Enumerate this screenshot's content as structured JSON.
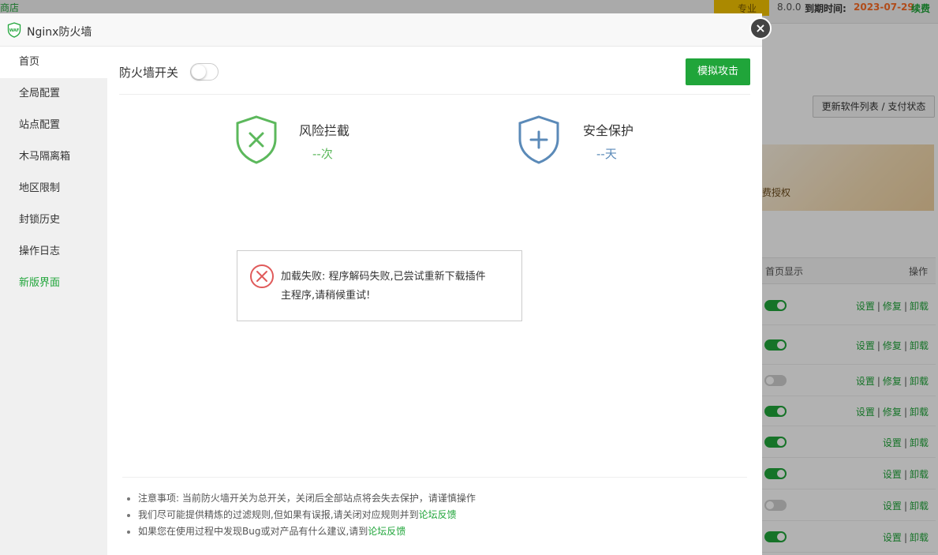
{
  "background": {
    "store_label": "商店",
    "pro_label": "专业",
    "version": "8.0.0",
    "expire_label": "到期时间:",
    "expire_date": "2023-07-29",
    "renew_label": "续费",
    "update_button": "更新软件列表 / 支付状态",
    "banner_text": "费授权",
    "table_headers": {
      "home_display": "首页显示",
      "operations": "操作"
    },
    "rows": [
      {
        "toggle_on": true,
        "ops": [
          "设置",
          "修复",
          "卸载"
        ]
      },
      {
        "toggle_on": true,
        "ops": [
          "设置",
          "修复",
          "卸载"
        ]
      },
      {
        "toggle_on": false,
        "ops": [
          "设置",
          "修复",
          "卸载"
        ]
      },
      {
        "toggle_on": true,
        "ops": [
          "设置",
          "修复",
          "卸载"
        ]
      },
      {
        "toggle_on": true,
        "ops": [
          "设置",
          "卸载"
        ]
      },
      {
        "toggle_on": true,
        "ops": [
          "设置",
          "卸载"
        ]
      },
      {
        "toggle_on": false,
        "ops": [
          "设置",
          "卸载"
        ]
      },
      {
        "toggle_on": true,
        "ops": [
          "设置",
          "卸载"
        ]
      }
    ]
  },
  "modal": {
    "title": "Nginx防火墙",
    "logo_text": "WAF",
    "close_icon": "×",
    "sidebar": [
      {
        "label": "首页",
        "active": true
      },
      {
        "label": "全局配置"
      },
      {
        "label": "站点配置"
      },
      {
        "label": "木马隔离箱"
      },
      {
        "label": "地区限制"
      },
      {
        "label": "封锁历史"
      },
      {
        "label": "操作日志"
      },
      {
        "label": "新版界面",
        "highlight": true
      }
    ],
    "firewall_switch_label": "防火墙开关",
    "firewall_on": false,
    "simulate_button": "模拟攻击",
    "stats": {
      "risk": {
        "title": "风险拦截",
        "value": "--次",
        "icon": "shield-x-icon",
        "color": "#5cb85c"
      },
      "protect": {
        "title": "安全保护",
        "value": "--天",
        "icon": "shield-plus-icon",
        "color": "#5b8ab8"
      }
    },
    "error": {
      "icon": "error-circle-icon",
      "line1": "加载失败: 程序解码失败,已尝试重新下载插件",
      "line2": "主程序,请稍候重试!"
    },
    "notes": {
      "note1": "注意事项: 当前防火墙开关为总开关，关闭后全部站点将会失去保护，请谨慎操作",
      "note2_text": "我们尽可能提供精炼的过滤规则,但如果有误报,请关闭对应规则并到",
      "note2_link": "论坛反馈",
      "note3_text": "如果您在使用过程中发现Bug或对产品有什么建议,请到",
      "note3_link": "论坛反馈"
    }
  },
  "colors": {
    "accent": "#20a53a",
    "risk": "#5cb85c",
    "protect": "#5b8ab8",
    "error": "#e05a5a",
    "expire": "#fc6d26"
  }
}
